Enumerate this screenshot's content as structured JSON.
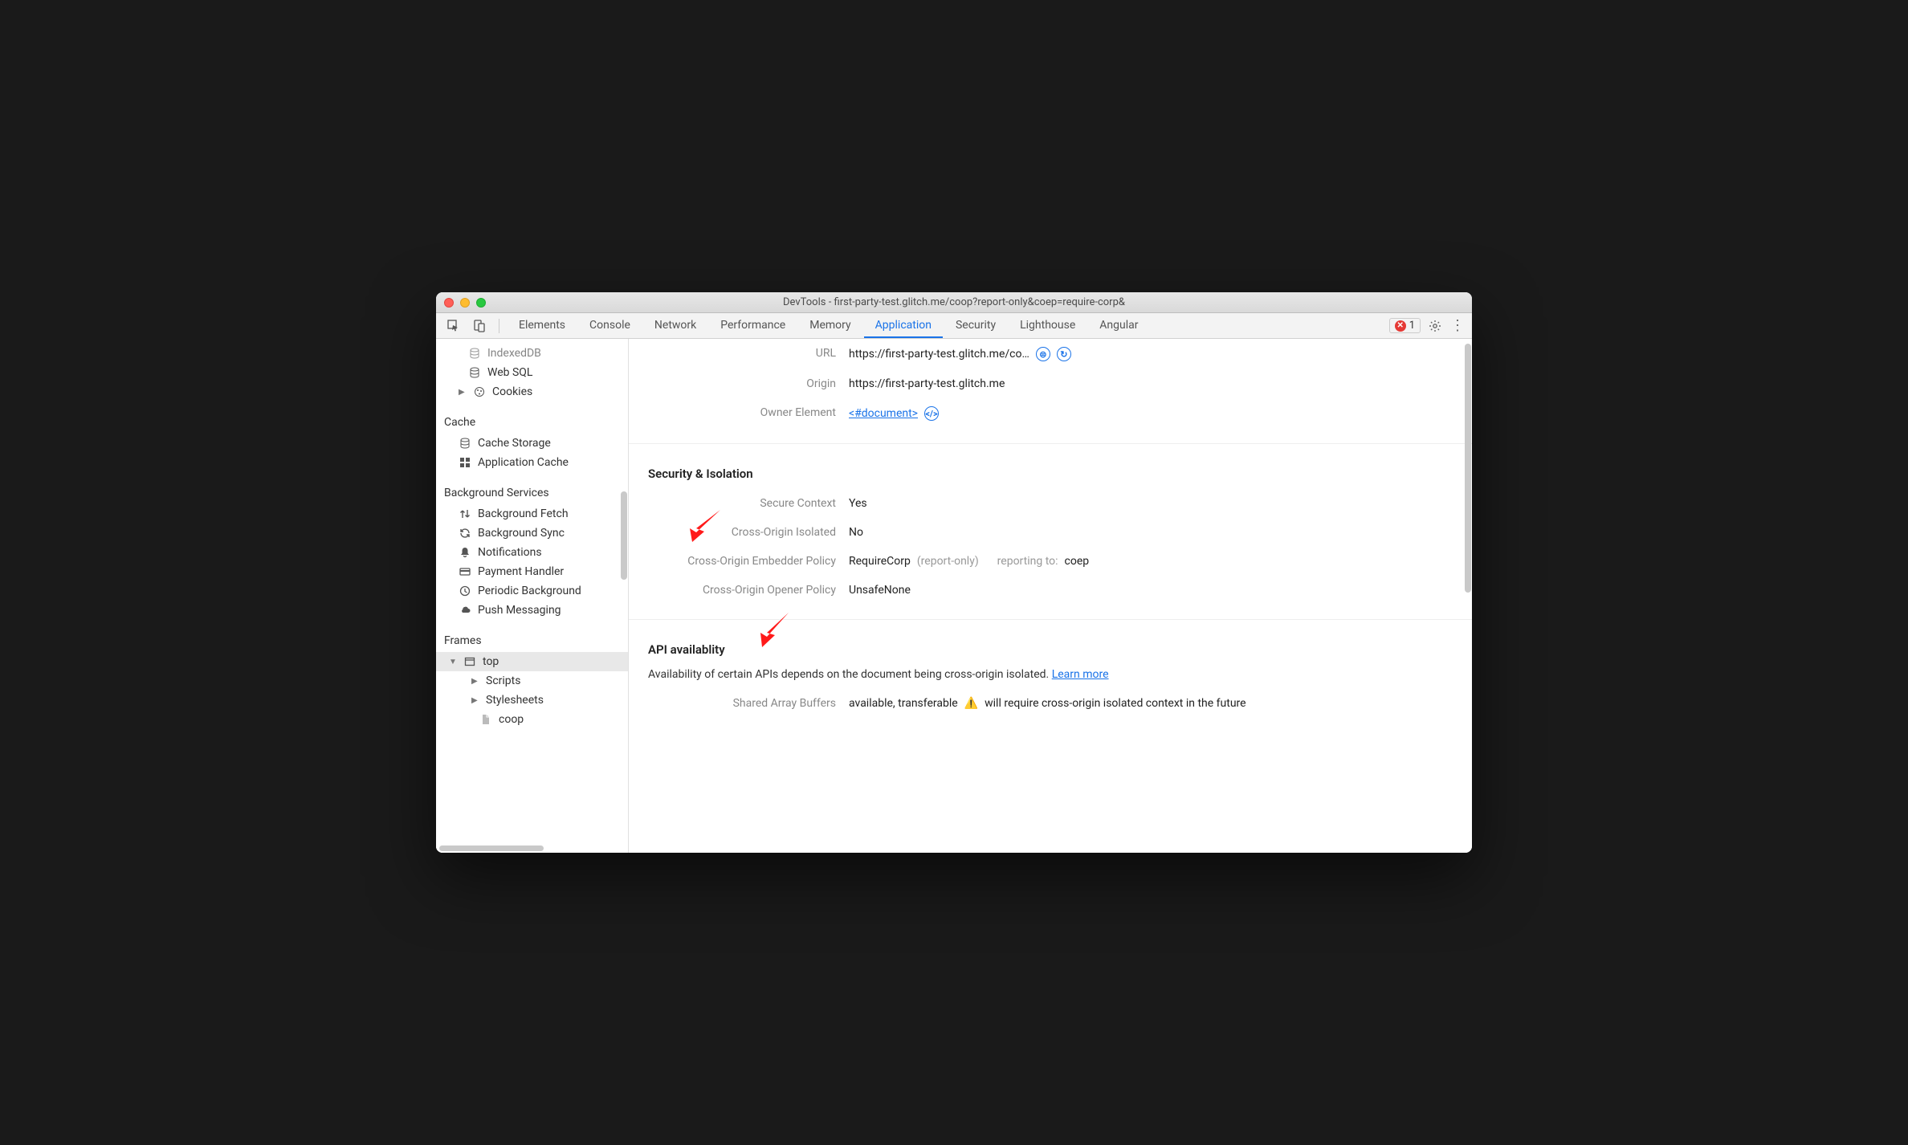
{
  "window": {
    "title": "DevTools - first-party-test.glitch.me/coop?report-only&coep=require-corp&"
  },
  "toolbar": {
    "tabs": [
      "Elements",
      "Console",
      "Network",
      "Performance",
      "Memory",
      "Application",
      "Security",
      "Lighthouse",
      "Angular"
    ],
    "activeTab": "Application",
    "errorCount": "1"
  },
  "sidebar": {
    "storage": {
      "items": [
        {
          "label": "IndexedDB",
          "icon": "db"
        },
        {
          "label": "Web SQL",
          "icon": "db"
        },
        {
          "label": "Cookies",
          "icon": "cookie",
          "caret": true
        }
      ]
    },
    "cache": {
      "title": "Cache",
      "items": [
        {
          "label": "Cache Storage",
          "icon": "db"
        },
        {
          "label": "Application Cache",
          "icon": "grid"
        }
      ]
    },
    "bg": {
      "title": "Background Services",
      "items": [
        {
          "label": "Background Fetch",
          "icon": "arrows"
        },
        {
          "label": "Background Sync",
          "icon": "sync"
        },
        {
          "label": "Notifications",
          "icon": "bell"
        },
        {
          "label": "Payment Handler",
          "icon": "card"
        },
        {
          "label": "Periodic Background",
          "icon": "clock"
        },
        {
          "label": "Push Messaging",
          "icon": "cloud"
        }
      ]
    },
    "frames": {
      "title": "Frames",
      "top": "top",
      "children": [
        "Scripts",
        "Stylesheets"
      ],
      "leaf": "coop"
    }
  },
  "main": {
    "document": {
      "url_label": "URL",
      "url_value": "https://first-party-test.glitch.me/co…",
      "origin_label": "Origin",
      "origin_value": "https://first-party-test.glitch.me",
      "owner_label": "Owner Element",
      "owner_link": "<#document>"
    },
    "security": {
      "title": "Security & Isolation",
      "rows": [
        {
          "label": "Secure Context",
          "value": "Yes"
        },
        {
          "label": "Cross-Origin Isolated",
          "value": "No"
        },
        {
          "label": "Cross-Origin Embedder Policy",
          "value": "RequireCorp",
          "suffix": "(report-only)",
          "reporting_label": "reporting to:",
          "reporting_value": "coep"
        },
        {
          "label": "Cross-Origin Opener Policy",
          "value": "UnsafeNone"
        }
      ]
    },
    "api": {
      "title": "API availablity",
      "desc_pre": "Availability of certain APIs depends on the document being cross-origin isolated. ",
      "learn": "Learn more",
      "sab_label": "Shared Array Buffers",
      "sab_value": "available, transferable",
      "sab_warn": "will require cross-origin isolated context in the future"
    }
  }
}
